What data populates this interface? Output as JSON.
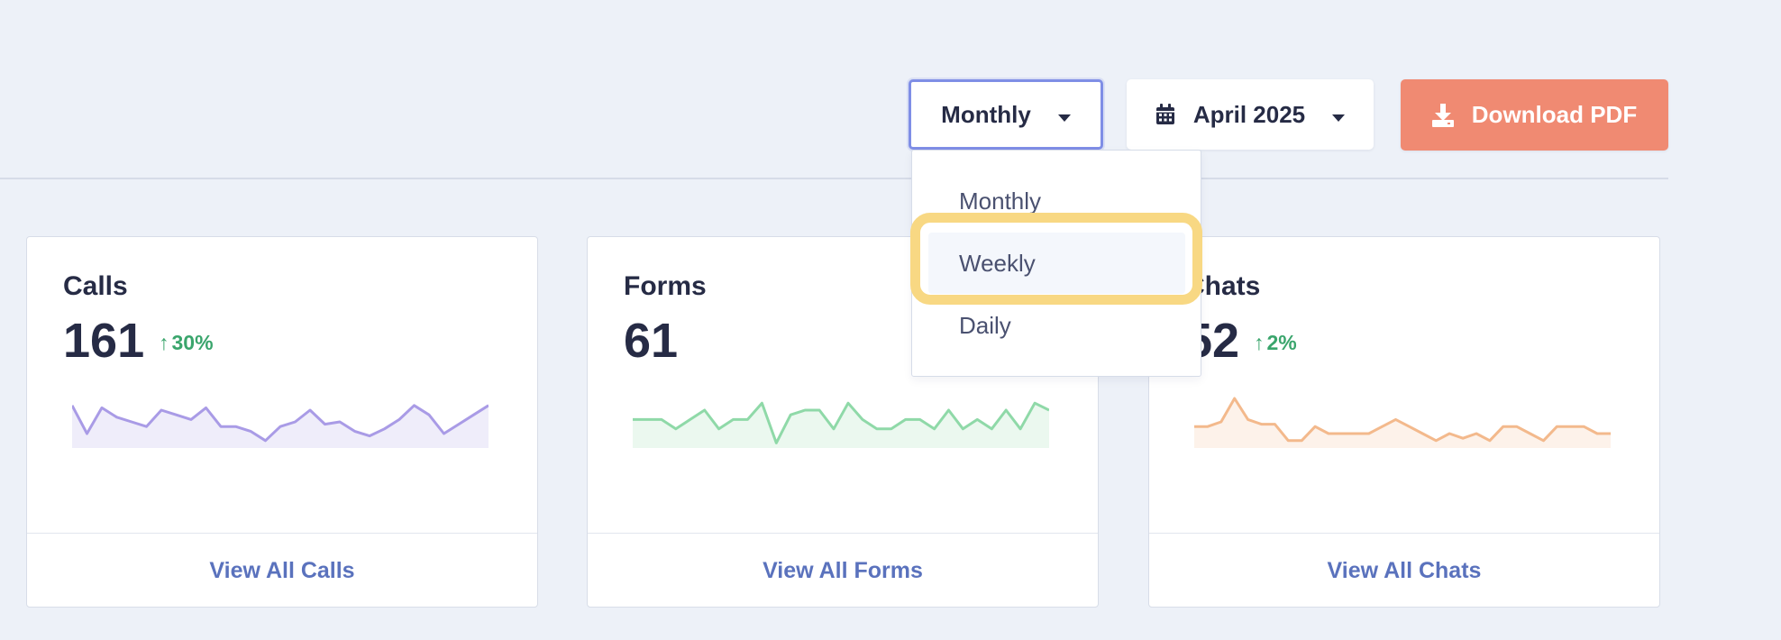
{
  "toolbar": {
    "period_label": "Monthly",
    "month_label": "April 2025",
    "download_label": "Download PDF"
  },
  "period_dropdown": {
    "options": [
      "Monthly",
      "Weekly",
      "Daily"
    ],
    "highlighted": "Weekly"
  },
  "colors": {
    "background": "#edf1f8",
    "download_button": "#f08a72",
    "focus_border": "#7f8ee6",
    "highlight_ring": "#f8d883",
    "positive_change": "#3aa56c",
    "link": "#5a72bd",
    "calls_line": "#a99be6",
    "forms_line": "#8fd9a8",
    "chats_line": "#f3b98c"
  },
  "cards": [
    {
      "title": "Calls",
      "value": "161",
      "change": "30%",
      "footer": "View All Calls",
      "spark": [
        8,
        20,
        9,
        13,
        15,
        17,
        10,
        12,
        14,
        9,
        17,
        17,
        19,
        23,
        17,
        15,
        10,
        16,
        15,
        19,
        21,
        18,
        14,
        8,
        12,
        20,
        16,
        12,
        8
      ]
    },
    {
      "title": "Forms",
      "value": "61",
      "change": "",
      "footer": "View All Forms",
      "spark": [
        14,
        14,
        14,
        18,
        14,
        10,
        18,
        14,
        14,
        7,
        24,
        12,
        10,
        10,
        18,
        7,
        14,
        18,
        18,
        14,
        14,
        18,
        10,
        18,
        14,
        18,
        10,
        18,
        7,
        10
      ]
    },
    {
      "title": "Chats",
      "value": "52",
      "change": "2%",
      "footer": "View All Chats",
      "spark": [
        17,
        17,
        15,
        5,
        14,
        16,
        16,
        23,
        23,
        17,
        20,
        20,
        20,
        20,
        17,
        14,
        17,
        20,
        23,
        20,
        22,
        20,
        23,
        17,
        17,
        20,
        23,
        17,
        17,
        17,
        20,
        20
      ]
    }
  ]
}
